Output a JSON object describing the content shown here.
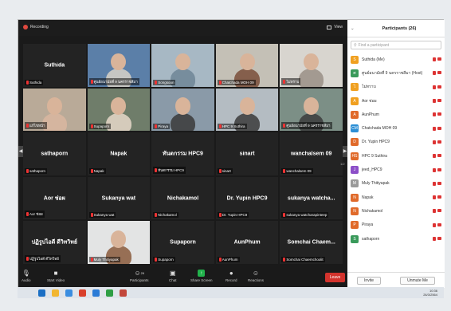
{
  "topbar": {
    "recording": "Recording",
    "view": "View"
  },
  "tiles": [
    {
      "name": "Suthida",
      "label": "Suthida",
      "video": false
    },
    {
      "name": "",
      "label": "ศูนย์อนามัยที่ 9 นครราชสีมา",
      "video": true,
      "bg": "#5b7fa8",
      "fg": "#d9d2c8"
    },
    {
      "name": "",
      "label": "Songsoon",
      "video": true,
      "bg": "#a7b8c4",
      "fg": "#6f8596"
    },
    {
      "name": "",
      "label": "Chatchada MOH 09",
      "video": true,
      "bg": "#c4c0b6",
      "fg": "#7a4d3a"
    },
    {
      "name": "",
      "label": "ไม่ทราบ",
      "video": true,
      "bg": "#d8d5cf",
      "fg": "#9a8f86"
    },
    {
      "name": "",
      "label": "แก้ไขหน้า",
      "video": true,
      "bg": "#b9aa98",
      "fg": "#d9b7a0"
    },
    {
      "name": "",
      "label": "Supaporn",
      "video": true,
      "bg": "#6f7d6a",
      "fg": "#e7d8c9"
    },
    {
      "name": "",
      "label": "Piraya",
      "video": true,
      "bg": "#8a9aa8",
      "fg": "#3a3a3a"
    },
    {
      "name": "",
      "label": "HPC 9 Suthira",
      "video": true,
      "bg": "#b4bcc2",
      "fg": "#3b3b3b"
    },
    {
      "name": "",
      "label": "ศูนย์อนามัยที่ 9 นครราชสีมา",
      "video": true,
      "bg": "#7c8f86",
      "fg": "#3c3c3c"
    },
    {
      "name": "sathaporn",
      "label": "sathaporn",
      "video": false
    },
    {
      "name": "Napak",
      "label": "Napak",
      "video": false
    },
    {
      "name": "ทันตกรรม HPC9",
      "label": "ทันตกรรม HPC9",
      "video": false
    },
    {
      "name": "sinart",
      "label": "sinart",
      "video": false
    },
    {
      "name": "wanchalsem 09",
      "label": "wanchalsem 09",
      "video": false
    },
    {
      "name": "Aor ช่อผ",
      "label": "Aor ช่อผ",
      "video": false
    },
    {
      "name": "Sukanya wat",
      "label": "Sukanya wat",
      "video": false
    },
    {
      "name": "Nichakamol",
      "label": "Nichakamol",
      "video": false
    },
    {
      "name": "Dr. Yupin HPC9",
      "label": "Dr. Yupin HPC9",
      "video": false
    },
    {
      "name": "sukanya watcha...",
      "label": "sukanya watcharapinteep",
      "video": false
    },
    {
      "name": "ปฏิรูปไอดี ดีวิทวิทย์",
      "label": "ปฏิรูปไอดี ดีวิทวิทย์",
      "video": false
    },
    {
      "name": "",
      "label": "Muly Thitiyapak",
      "video": true,
      "bg": "#e3e4e4",
      "fg": "#8a5a3c"
    },
    {
      "name": "Supaporn",
      "label": "Supaporn",
      "video": false
    },
    {
      "name": "AunPhum",
      "label": "AunPhum",
      "video": false
    },
    {
      "name": "Somchai Chaem...",
      "label": "Somchai Chaemchoolit",
      "video": false
    }
  ],
  "page_indicator": "1/2",
  "toolbar": {
    "audio": "Audio",
    "start_video": "Start Video",
    "participants": "Participants",
    "participants_count": "26",
    "chat": "Chat",
    "share_screen": "Share Screen",
    "record": "Record",
    "reactions": "Reactions",
    "leave": "Leave"
  },
  "panel": {
    "title": "Participants (26)",
    "find_placeholder": "Find a participant",
    "invite": "Invite",
    "unmute_me": "Unmute Me",
    "participants": [
      {
        "initial": "S",
        "name": "Suthida (Me)",
        "color": "#f0a020"
      },
      {
        "initial": "ศ",
        "name": "ศูนย์อนามัยที่ 9 นครราชสีมา (Host)",
        "color": "#3a9a5b"
      },
      {
        "initial": "ไ",
        "name": "ไม่ทราบ",
        "color": "#f0a020"
      },
      {
        "initial": "A",
        "name": "Aor ช่อผ",
        "color": "#f0a020"
      },
      {
        "initial": "A",
        "name": "AunPhum",
        "color": "#e06a2a"
      },
      {
        "initial": "CM",
        "name": "Chatchada MOH 09",
        "color": "#2d8fd5"
      },
      {
        "initial": "D",
        "name": "Dr. Yupin HPC9",
        "color": "#e06a2a"
      },
      {
        "initial": "HS",
        "name": "HPC 9 Suthira",
        "color": "#e06a2a"
      },
      {
        "initial": "J",
        "name": "jeed_HPC9",
        "color": "#8c4fc8"
      },
      {
        "initial": "M",
        "name": "Muly Thitiyapak",
        "color": "#9a9a9a"
      },
      {
        "initial": "N",
        "name": "Napak",
        "color": "#e06a2a"
      },
      {
        "initial": "N",
        "name": "Nichakamol",
        "color": "#e06a2a"
      },
      {
        "initial": "P",
        "name": "Piraya",
        "color": "#e06a2a"
      },
      {
        "initial": "S",
        "name": "sathaporn",
        "color": "#3a9a5b"
      }
    ]
  },
  "taskbar": {
    "time": "10:36",
    "date": "26/3/2564"
  }
}
